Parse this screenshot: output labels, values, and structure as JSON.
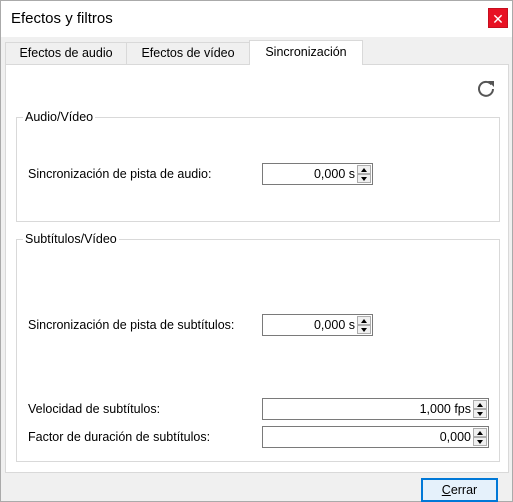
{
  "window": {
    "title": "Efectos y filtros",
    "close_glyph": "✕"
  },
  "tabs": [
    {
      "label": "Efectos de audio",
      "active": false
    },
    {
      "label": "Efectos de vídeo",
      "active": false
    },
    {
      "label": "Sincronización",
      "active": true
    }
  ],
  "reset_icon": "refresh-icon",
  "audio_video": {
    "legend": "Audio/Vídeo",
    "audio_sync_label": "Sincronización de pista de audio:",
    "audio_sync_value": "0,000 s"
  },
  "subtitles_video": {
    "legend": "Subtítulos/Vídeo",
    "subtitle_sync_label": "Sincronización de pista de subtítulos:",
    "subtitle_sync_value": "0,000 s",
    "subtitle_speed_label": "Velocidad de subtítulos:",
    "subtitle_speed_value": "1,000 fps",
    "subtitle_duration_label": "Factor de duración de subtítulos:",
    "subtitle_duration_value": "0,000"
  },
  "footer": {
    "close_label_first": "C",
    "close_label_rest": "errar"
  }
}
